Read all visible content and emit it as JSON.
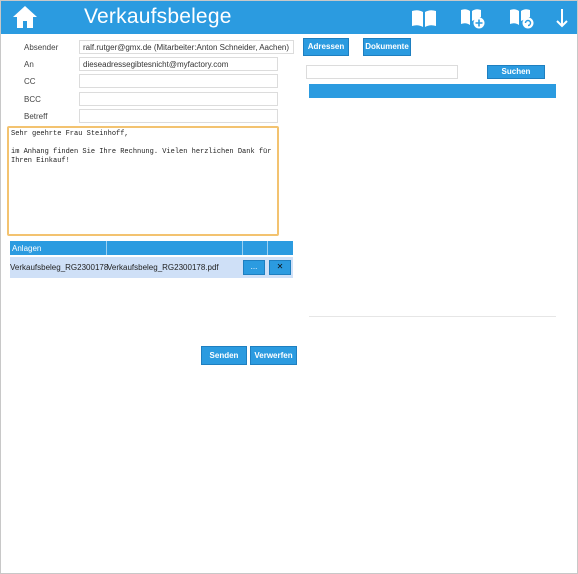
{
  "header": {
    "title": "Verkaufsbelege",
    "icons": [
      "home-icon",
      "book-icon",
      "book-add-icon",
      "book-refresh-icon",
      "arrow-down-icon"
    ]
  },
  "form": {
    "absender_label": "Absender",
    "absender_value": "ralf.rutger@gmx.de (Mitarbeiter:Anton Schneider, Aachen)",
    "an_label": "An",
    "an_value": "dieseadressegibtesnicht@myfactory.com",
    "cc_label": "CC",
    "cc_value": "",
    "bcc_label": "BCC",
    "bcc_value": "",
    "betreff_label": "Betreff",
    "betreff_value": "",
    "message": "Sehr geehrte Frau Steinhoff,\n\nim Anhang finden Sie Ihre Rechnung. Vielen herzlichen Dank für\nIhren Einkauf!"
  },
  "buttons": {
    "adressen": "Adressen",
    "dokumente": "Dokumente",
    "suchen": "Suchen",
    "senden": "Senden",
    "verwerfen": "Verwerfen",
    "dots": "...",
    "remove": "✕"
  },
  "attachments": {
    "header": "Anlagen",
    "rows": [
      {
        "name": "Verkaufsbeleg_RG2300178",
        "file": "Verkaufsbeleg_RG2300178.pdf"
      }
    ]
  },
  "colors": {
    "accent": "#2b9be0",
    "highlight": "#f3c370",
    "row": "#cfe0f7"
  }
}
